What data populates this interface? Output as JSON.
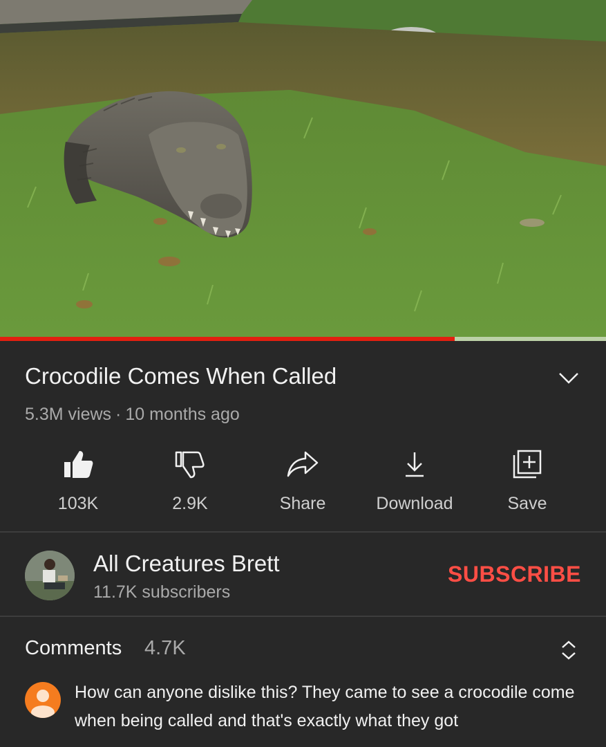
{
  "video": {
    "progress_fraction": 0.75
  },
  "details": {
    "title": "Crocodile Comes When Called",
    "views": "5.3M views",
    "separator": "·",
    "age": "10 months ago"
  },
  "actions": {
    "like": {
      "label": "103K",
      "icon": "thumbs-up-icon"
    },
    "dislike": {
      "label": "2.9K",
      "icon": "thumbs-down-icon"
    },
    "share": {
      "label": "Share",
      "icon": "share-icon"
    },
    "download": {
      "label": "Download",
      "icon": "download-icon"
    },
    "save": {
      "label": "Save",
      "icon": "add-to-playlist-icon"
    }
  },
  "channel": {
    "name": "All Creatures Brett",
    "subscribers": "11.7K subscribers",
    "subscribe_label": "SUBSCRIBE"
  },
  "comments": {
    "label": "Comments",
    "count": "4.7K",
    "top_comment": "How can anyone dislike this? They came to see a crocodile come when being called and that's exactly what they got"
  },
  "colors": {
    "background": "#282828",
    "progress": "#e32010",
    "subscribe": "#ff4e45",
    "comment_avatar": "#f57c1f"
  }
}
